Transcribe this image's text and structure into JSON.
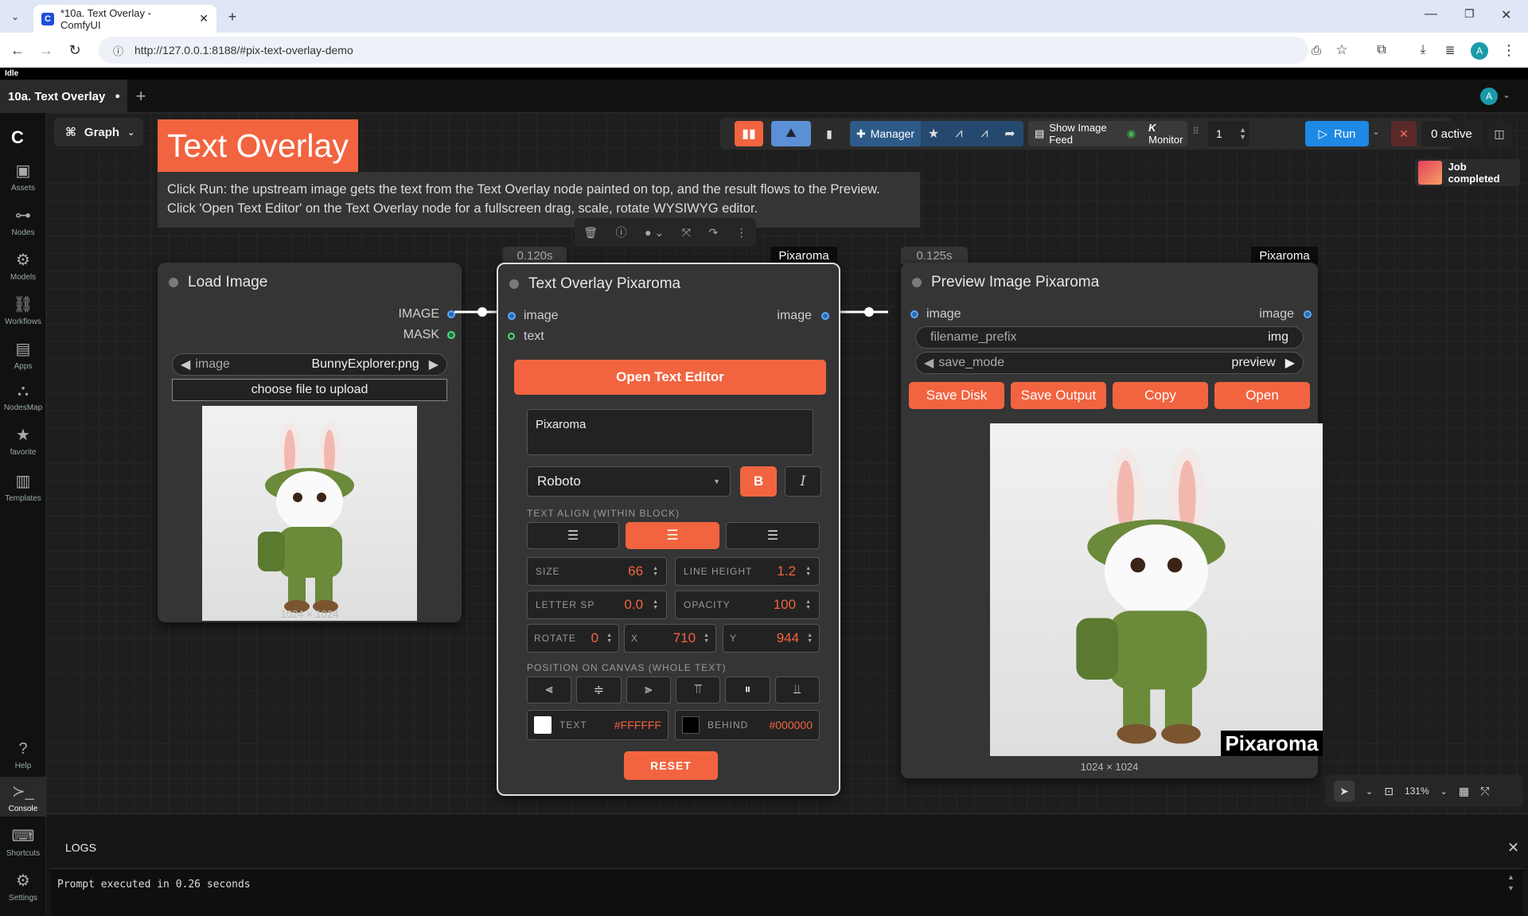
{
  "browser": {
    "tab_title": "*10a. Text Overlay - ComfyUI",
    "url": "http://127.0.0.1:8188/#pix-text-overlay-demo",
    "profile_initial": "A"
  },
  "status": "Idle",
  "workflow_tab": {
    "label": "10a. Text Overlay",
    "unsaved": "●"
  },
  "user_initial": "A",
  "sidebar": [
    {
      "label": "Assets",
      "icon": "assets-icon"
    },
    {
      "label": "Nodes",
      "icon": "nodes-icon"
    },
    {
      "label": "Models",
      "icon": "models-icon"
    },
    {
      "label": "Workflows",
      "icon": "workflows-icon"
    },
    {
      "label": "Apps",
      "icon": "apps-icon"
    },
    {
      "label": "NodesMap",
      "icon": "nodesmap-icon"
    },
    {
      "label": "favorite",
      "icon": "star-icon"
    },
    {
      "label": "Templates",
      "icon": "templates-icon"
    },
    {
      "label": "Help",
      "icon": "help-icon"
    },
    {
      "label": "Console",
      "icon": "console-icon"
    },
    {
      "label": "Shortcuts",
      "icon": "keyboard-icon"
    },
    {
      "label": "Settings",
      "icon": "gear-icon"
    }
  ],
  "graph_button": "Graph",
  "toolbar": {
    "manager": "Manager",
    "show_feed": "Show Image Feed",
    "monitor": "Monitor",
    "queue_count": "1",
    "run": "Run",
    "active": "0 active"
  },
  "toast": "Job completed",
  "note": {
    "title": "Text Overlay",
    "text1": "Click Run: the upstream image gets the text from the Text Overlay node painted on top, and the result flows to the Preview.",
    "text2": "Click 'Open Text Editor' on the Text Overlay node for a fullscreen drag, scale, rotate WYSIWYG editor."
  },
  "load_image": {
    "title": "Load Image",
    "out_image": "IMAGE",
    "out_mask": "MASK",
    "widget_label": "image",
    "widget_value": "BunnyExplorer.png",
    "upload": "choose file to upload",
    "dims": "1024 × 1024"
  },
  "overlay": {
    "time": "0.120s",
    "badge": "Pixaroma",
    "title": "Text Overlay Pixaroma",
    "in_image": "image",
    "in_text": "text",
    "out_image": "image",
    "open_editor": "Open Text Editor",
    "text_value": "Pixaroma",
    "font": "Roboto",
    "bold": "B",
    "italic": "I",
    "align_label": "TEXT ALIGN (WITHIN BLOCK)",
    "size_label": "SIZE",
    "size": "66",
    "lh_label": "LINE HEIGHT",
    "lh": "1.2",
    "ls_label": "LETTER SP",
    "ls": "0.0",
    "op_label": "OPACITY",
    "op": "100",
    "rot_label": "ROTATE",
    "rot": "0",
    "x_label": "X",
    "x": "710",
    "y_label": "Y",
    "y": "944",
    "pos_label": "POSITION ON CANVAS (WHOLE TEXT)",
    "text_label": "TEXT",
    "text_color": "#FFFFFF",
    "behind_label": "BEHIND",
    "behind_color": "#000000",
    "reset": "RESET"
  },
  "preview": {
    "time": "0.125s",
    "badge": "Pixaroma",
    "title": "Preview Image Pixaroma",
    "in_image": "image",
    "out_image": "image",
    "prefix_label": "filename_prefix",
    "prefix": "img",
    "mode_label": "save_mode",
    "mode": "preview",
    "save_disk": "Save Disk",
    "save_output": "Save Output",
    "copy": "Copy",
    "open": "Open",
    "overlay_text": "Pixaroma",
    "dims": "1024 × 1024"
  },
  "zoom": "131%",
  "logs": {
    "title": "LOGS",
    "line": "Prompt executed in 0.26 seconds"
  },
  "colors": {
    "accent": "#f26440",
    "run_blue": "#1e88e5",
    "port_blue": "#5aa8ff"
  }
}
